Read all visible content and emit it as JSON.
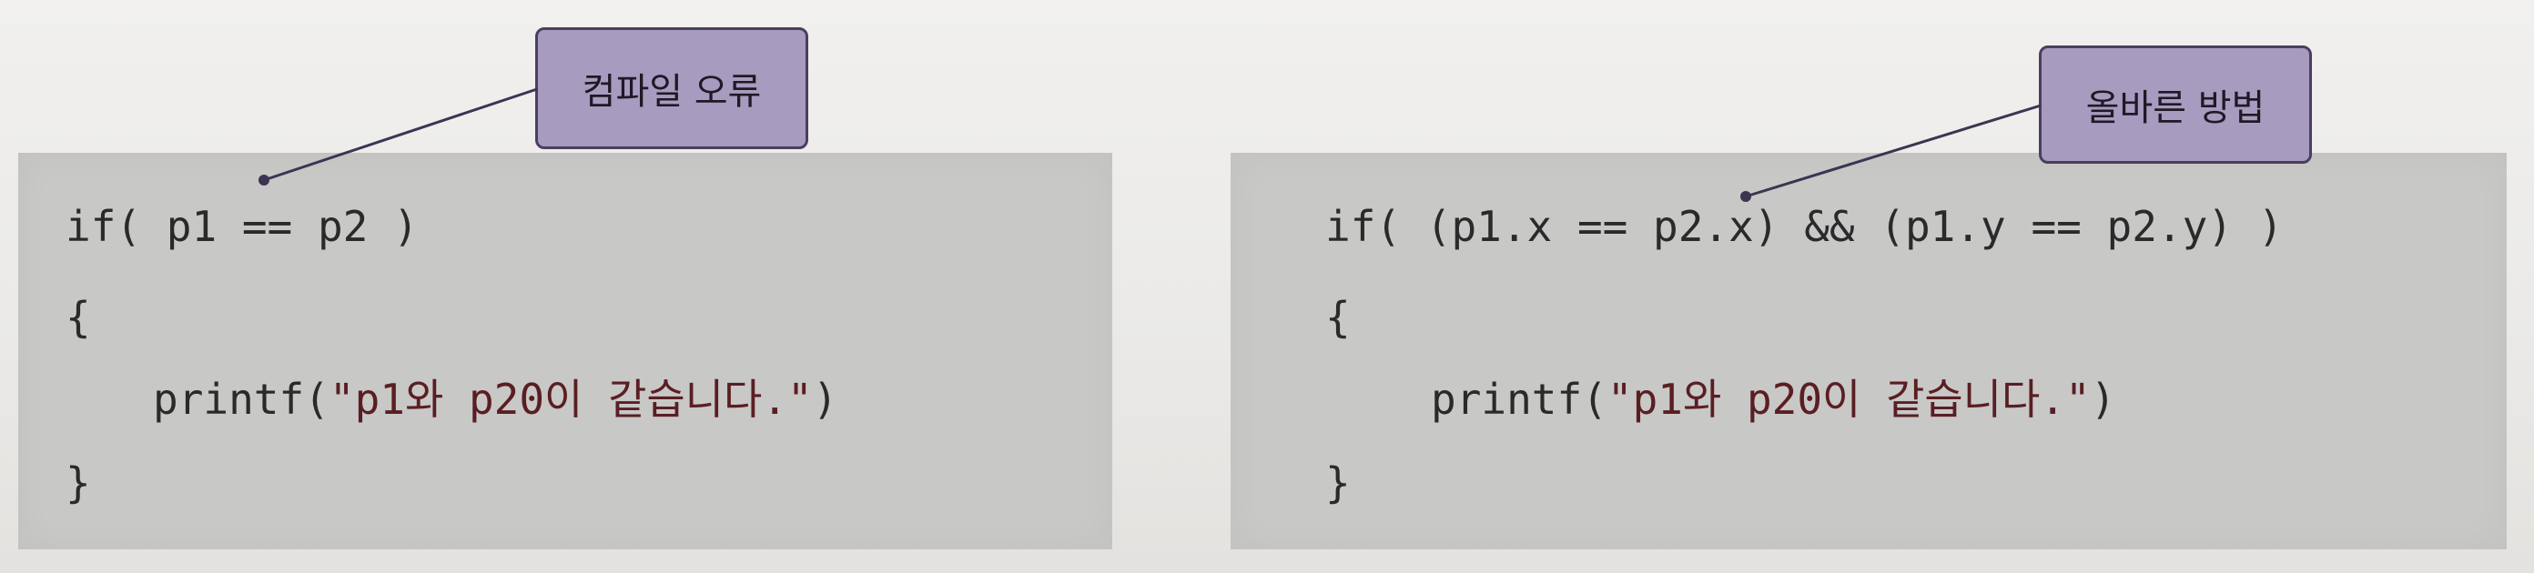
{
  "left": {
    "label": "컴파일 오류",
    "code": {
      "line1": "if( p1 == p2 )",
      "line2": "{",
      "line3_func": "printf(",
      "line3_str": "\"p1와 p20이 같습니다.\"",
      "line3_end": ")",
      "line4": "}"
    }
  },
  "right": {
    "label": "올바른 방법",
    "code": {
      "line1": "if( (p1.x == p2.x) && (p1.y == p2.y) )",
      "line2": "{",
      "line3_func": "printf(",
      "line3_str": "\"p1와 p20이 같습니다.\"",
      "line3_end": ")",
      "line4": "}"
    }
  },
  "colors": {
    "code_bg": "#c8c8c7",
    "label_bg": "#a79cbf",
    "label_border": "#4a3f5c",
    "string_text": "#5a1e22",
    "code_text": "#2a2a2a"
  }
}
